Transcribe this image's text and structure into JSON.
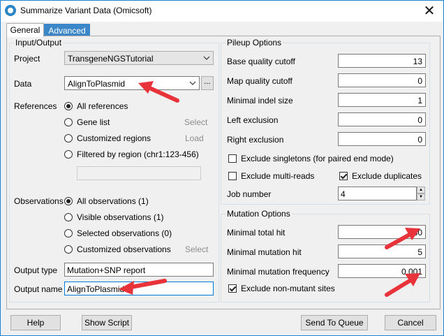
{
  "window": {
    "title": "Summarize Variant Data (Omicsoft)",
    "close_glyph": "✕"
  },
  "tabs": [
    {
      "label": "General"
    },
    {
      "label": "Advanced"
    }
  ],
  "io": {
    "group_title": "Input/Output",
    "project_label": "Project",
    "project_value": "TransgeneNGSTutorial",
    "data_label": "Data",
    "data_value": "AlignToPlasmid",
    "browse_label": "...",
    "references_label": "References",
    "references_options": [
      "All references",
      "Gene list",
      "Customized regions",
      "Filtered by region (chr1:123-456)"
    ],
    "gene_list_select": "Select",
    "custom_regions_load": "Load",
    "observations_label": "Observations",
    "observations_options": [
      "All observations (1)",
      "Visible observations (1)",
      "Selected observations (0)",
      "Customized observations"
    ],
    "customized_observations_select": "Select",
    "output_type_label": "Output type",
    "output_type_value": "Mutation+SNP report",
    "output_name_label": "Output name",
    "output_name_value": "AlignToPlasmid"
  },
  "pileup": {
    "group_title": "Pileup Options",
    "base_quality_label": "Base quality cutoff",
    "base_quality_value": "13",
    "map_quality_label": "Map quality cutoff",
    "map_quality_value": "0",
    "min_indel_label": "Minimal indel size",
    "min_indel_value": "1",
    "left_exclusion_label": "Left exclusion",
    "left_exclusion_value": "0",
    "right_exclusion_label": "Right exclusion",
    "right_exclusion_value": "0",
    "exclude_singletons_label": "Exclude singletons (for paired end mode)",
    "exclude_multireads_label": "Exclude multi-reads",
    "exclude_duplicates_label": "Exclude duplicates",
    "job_number_label": "Job number",
    "job_number_value": "4"
  },
  "mutation": {
    "group_title": "Mutation Options",
    "min_total_hit_label": "Minimal total hit",
    "min_total_hit_value": "30",
    "min_mutation_hit_label": "Minimal mutation hit",
    "min_mutation_hit_value": "5",
    "min_mutation_freq_label": "Minimal mutation frequency",
    "min_mutation_freq_value": "0.001",
    "exclude_nonmutant_label": "Exclude non-mutant sites"
  },
  "footer": {
    "help": "Help",
    "show_script": "Show Script",
    "send_to_queue": "Send To Queue",
    "cancel": "Cancel"
  },
  "colors": {
    "annotation_arrow": "#e8333a",
    "tab_active_bg": "#3c87c7"
  }
}
